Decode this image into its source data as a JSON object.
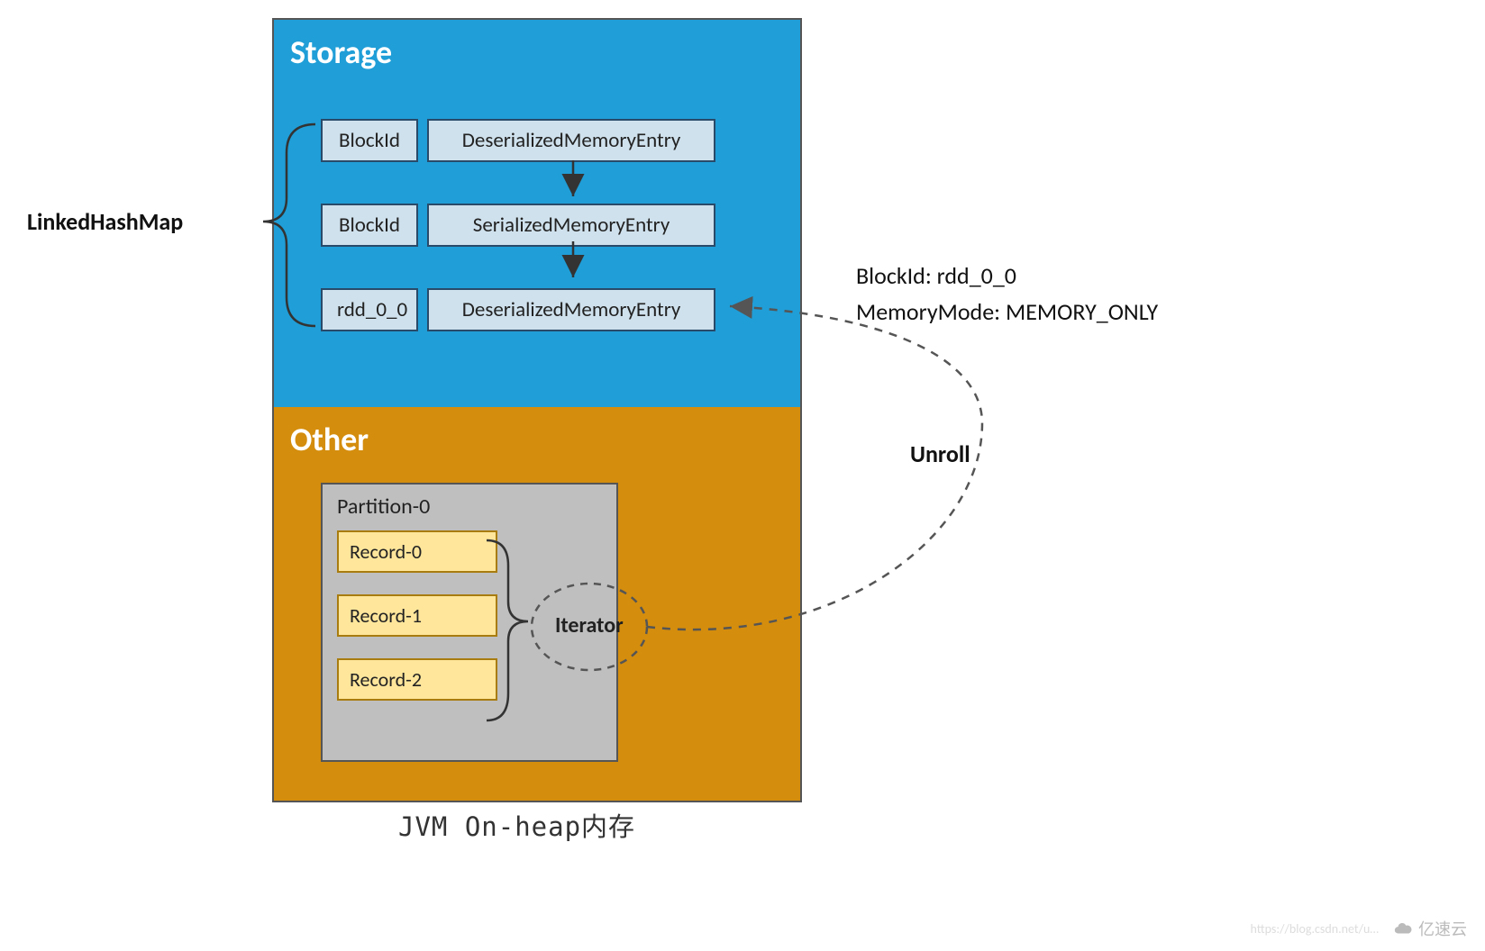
{
  "left_label": "LinkedHashMap",
  "storage": {
    "title": "Storage",
    "rows": [
      {
        "key": "BlockId",
        "value": "DeserializedMemoryEntry"
      },
      {
        "key": "BlockId",
        "value": "SerializedMemoryEntry"
      },
      {
        "key": "rdd_0_0",
        "value": "DeserializedMemoryEntry"
      }
    ]
  },
  "other": {
    "title": "Other",
    "partition": {
      "title": "Partition-0",
      "records": [
        "Record-0",
        "Record-1",
        "Record-2"
      ]
    },
    "iterator_label": "Iterator"
  },
  "annotations": {
    "blockid": "BlockId:  rdd_0_0",
    "memorymode": "MemoryMode:   MEMORY_ONLY",
    "unroll": "Unroll"
  },
  "caption": "JVM On-heap内存",
  "watermark": {
    "faint": "https://blog.csdn.net/u…",
    "brand": "亿速云"
  }
}
